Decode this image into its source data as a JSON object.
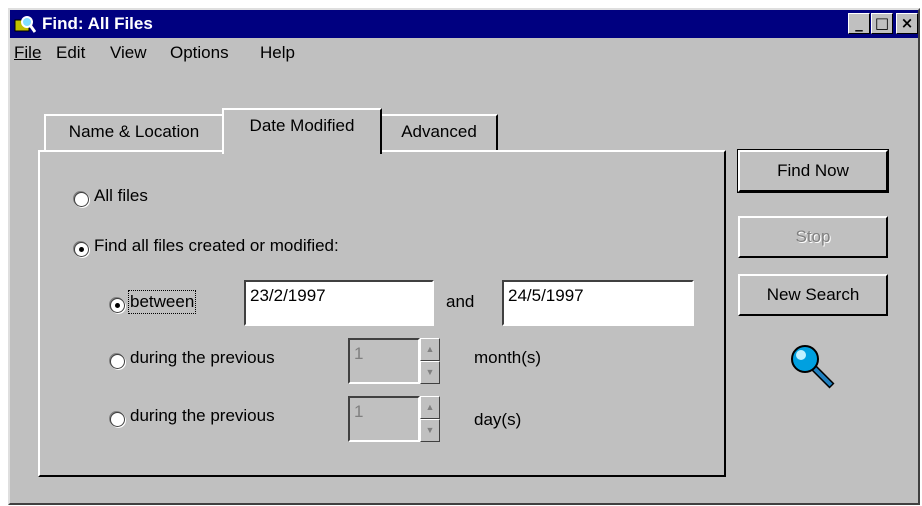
{
  "window": {
    "title": "Find: All Files",
    "controls": {
      "minimize": "_",
      "maximize": "□",
      "close": "×"
    }
  },
  "menu": [
    "File",
    "Edit",
    "View",
    "Options",
    "Help"
  ],
  "tabs": {
    "items": [
      "Name & Location",
      "Date Modified",
      "Advanced"
    ],
    "active": "Date Modified"
  },
  "date_modified": {
    "all_files_label": "All files",
    "find_all_label": "Find all files created or modified:",
    "between_label": "between",
    "from_date": "23/2/1997",
    "and_label": "and",
    "to_date": "24/5/1997",
    "prev_months_label": "during the previous",
    "months_value": "1",
    "months_unit": "month(s)",
    "prev_days_label": "during the previous",
    "days_value": "1",
    "days_unit": "day(s)"
  },
  "buttons": {
    "find_now": "Find Now",
    "stop": "Stop",
    "new_search": "New Search"
  },
  "colors": {
    "title_bar": "#000080",
    "face": "#c0c0c0",
    "magnifier_lens": "#00a0e0"
  },
  "icons": [
    "search-folder-icon",
    "magnifier-icon",
    "spin-up-icon",
    "spin-down-icon"
  ]
}
